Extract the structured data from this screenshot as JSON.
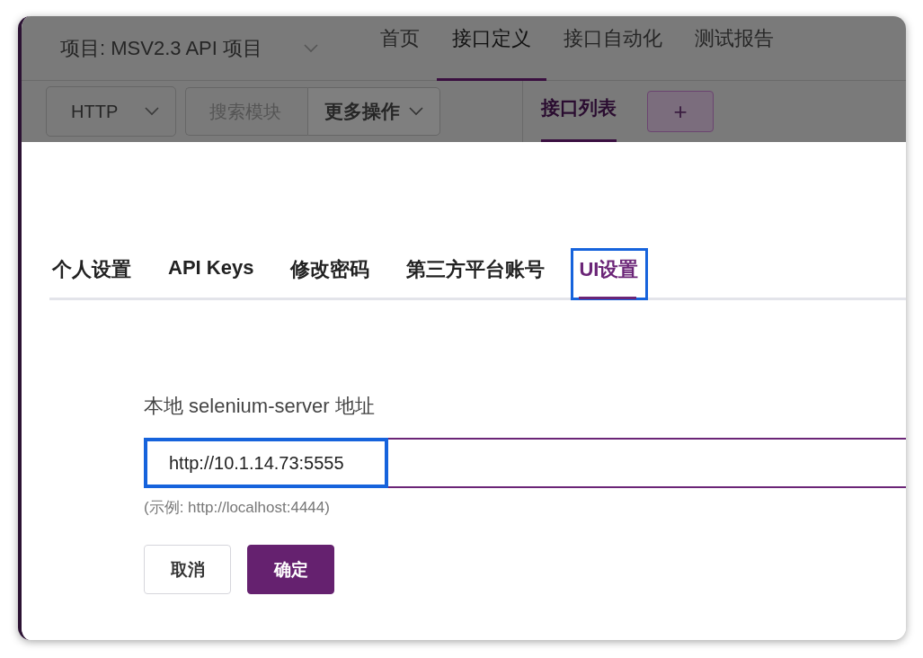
{
  "project_select": {
    "label": "项目: MSV2.3 API 项目"
  },
  "nav": [
    {
      "label": "首页",
      "selected": false
    },
    {
      "label": "接口定义",
      "selected": true
    },
    {
      "label": "接口自动化",
      "selected": false
    },
    {
      "label": "测试报告",
      "selected": false
    }
  ],
  "toolbar": {
    "protocol": "HTTP",
    "search": {
      "placeholder": "搜索模块"
    },
    "more": "更多操作",
    "tab": "接口列表",
    "add": "+"
  },
  "dialog": {
    "tabs": [
      {
        "label": "个人设置",
        "selected": false,
        "highlighted": false
      },
      {
        "label": "API Keys",
        "selected": false,
        "highlighted": false
      },
      {
        "label": "修改密码",
        "selected": false,
        "highlighted": false
      },
      {
        "label": "第三方平台账号",
        "selected": false,
        "highlighted": false
      },
      {
        "label": "UI设置",
        "selected": true,
        "highlighted": true
      }
    ],
    "field": {
      "label": "本地 selenium-server 地址",
      "value": "http://10.1.14.73:5555",
      "highlighted": true,
      "hint": "(示例: http://localhost:4444)"
    },
    "buttons": [
      {
        "label": "取消",
        "kind": "secondary"
      },
      {
        "label": "确定",
        "kind": "primary"
      }
    ]
  }
}
